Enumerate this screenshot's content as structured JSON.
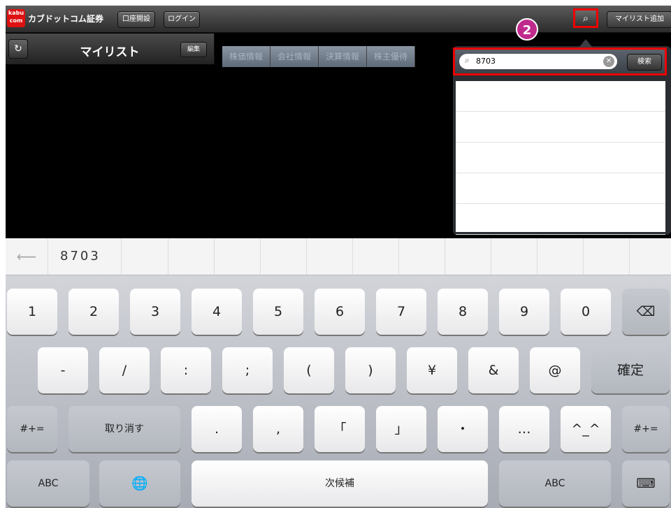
{
  "header": {
    "logo_text": "kabu com",
    "brand_name": "カブドットコム証券",
    "open_account_label": "口座開設",
    "login_label": "ログイン",
    "add_mylist_label": "マイリスト追加"
  },
  "left_pane": {
    "title": "マイリスト",
    "edit_label": "編集"
  },
  "tabs": [
    "株価情報",
    "会社情報",
    "決算情報",
    "株主優待"
  ],
  "step_badge": "2",
  "search": {
    "value": "8703",
    "button_label": "検索"
  },
  "results_rows": 5,
  "keyboard": {
    "candidate_first": "8703",
    "row1": [
      "1",
      "2",
      "3",
      "4",
      "5",
      "6",
      "7",
      "8",
      "9",
      "0"
    ],
    "row2": [
      "-",
      "/",
      ":",
      ";",
      "(",
      ")",
      "¥",
      "&",
      "@"
    ],
    "confirm_label": "確定",
    "row3_left": "#+=",
    "undo_label": "取り消す",
    "row3": [
      ".",
      ",",
      "「",
      "」",
      "・",
      "…",
      "^_^"
    ],
    "row3_right": "#+=",
    "abc_left": "ABC",
    "next_candidate_label": "次候補",
    "abc_right": "ABC"
  },
  "colors": {
    "highlight": "#ee0000",
    "badge": "#c02a8c"
  }
}
